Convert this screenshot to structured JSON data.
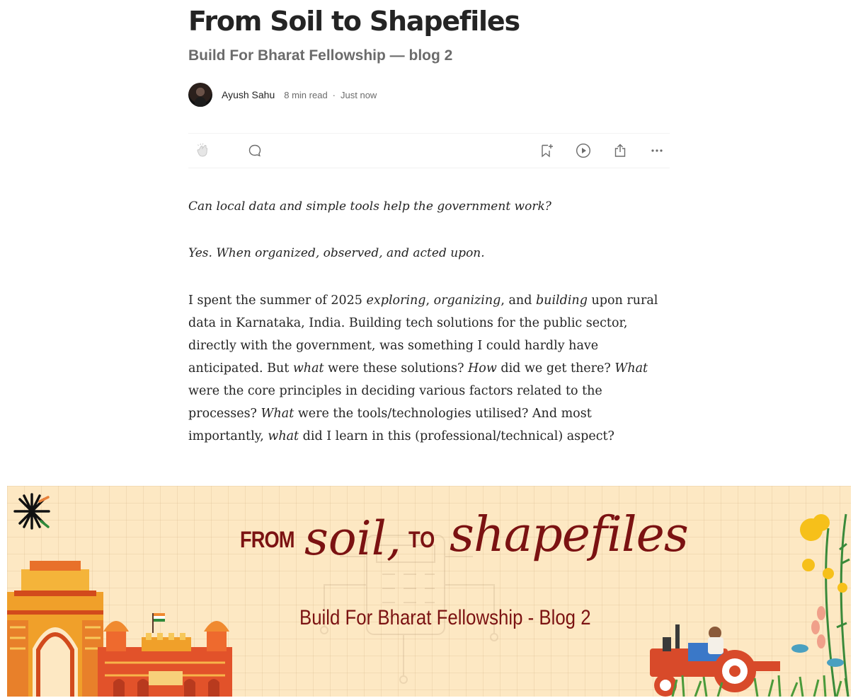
{
  "article": {
    "title": "From Soil to Shapefiles",
    "subtitle": "Build For Bharat Fellowship — blog 2",
    "author": "Ayush Sahu",
    "read_time": "8 min read",
    "separator": "·",
    "posted": "Just now"
  },
  "actions": {
    "icons": [
      "clap-icon",
      "comment-icon",
      "bookmark-add-icon",
      "play-icon",
      "share-icon",
      "more-icon"
    ]
  },
  "body": {
    "question": "Can local data and simple tools help the government work?",
    "answer": "Yes. When organized, observed, and acted upon.",
    "paragraph": [
      {
        "t": "I spent the summer of 2025 ",
        "i": false
      },
      {
        "t": "exploring",
        "i": true
      },
      {
        "t": ", ",
        "i": false
      },
      {
        "t": "organizing",
        "i": true
      },
      {
        "t": ", and ",
        "i": false
      },
      {
        "t": "building",
        "i": true
      },
      {
        "t": " upon rural data in Karnataka, India. Building tech solutions for the public sector, directly with the government, was something I could hardly have anticipated. But ",
        "i": false
      },
      {
        "t": "what",
        "i": true
      },
      {
        "t": " were these solutions? ",
        "i": false
      },
      {
        "t": "How",
        "i": true
      },
      {
        "t": " did we get there? ",
        "i": false
      },
      {
        "t": "What",
        "i": true
      },
      {
        "t": " were the core principles in deciding various factors related to the processes? ",
        "i": false
      },
      {
        "t": "What",
        "i": true
      },
      {
        "t": " were the tools/technologies utilised? And most importantly, ",
        "i": false
      },
      {
        "t": "what",
        "i": true
      },
      {
        "t": " did I learn in this (professional/technical) aspect?",
        "i": false
      }
    ]
  },
  "banner": {
    "from": "FROM",
    "soil": "soil,",
    "to": "TO",
    "shapefiles": "shapefiles",
    "subtitle": "Build For Bharat Fellowship - Blog 2"
  },
  "colors": {
    "banner_bg": "#fde8c3",
    "banner_text": "#7b1212",
    "muted": "#6b6b6b",
    "icon": "#6b6b6b"
  }
}
